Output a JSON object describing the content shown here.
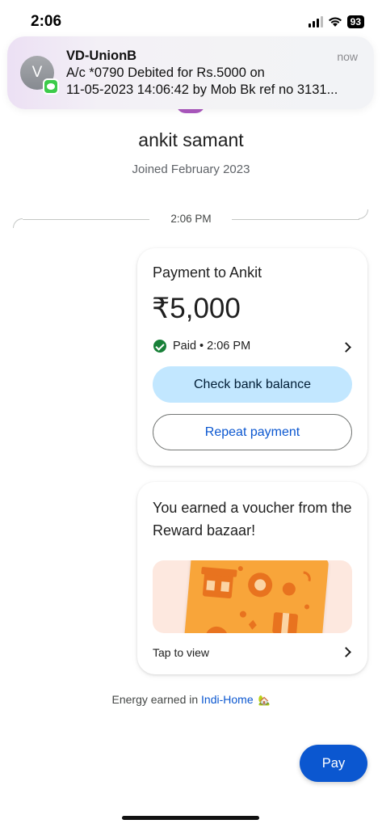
{
  "status_bar": {
    "time": "2:06",
    "battery": "93"
  },
  "notification": {
    "avatar_letter": "V",
    "sender": "VD-UnionB",
    "time": "now",
    "body_line1": "A/c *0790 Debited for Rs.5000 on",
    "body_line2": "11-05-2023 14:06:42 by Mob Bk ref no 3131..."
  },
  "profile": {
    "name": "ankit samant",
    "joined": "Joined February 2023"
  },
  "timeline": {
    "time": "2:06 PM"
  },
  "payment": {
    "title": "Payment to Ankit",
    "amount": "₹5,000",
    "status": "Paid • 2:06 PM",
    "check_balance_label": "Check bank balance",
    "repeat_label": "Repeat payment"
  },
  "voucher": {
    "title": "You earned a voucher from the Reward bazaar!",
    "tap_label": "Tap to view"
  },
  "energy": {
    "prefix": "Energy earned in ",
    "link": "Indi-Home",
    "icon": "🏡"
  },
  "pay_button": {
    "label": "Pay"
  },
  "colors": {
    "accent": "#0b57d0",
    "balance_button": "#c2e7ff",
    "paid_green": "#188038",
    "voucher_orange": "#f8a53a"
  }
}
